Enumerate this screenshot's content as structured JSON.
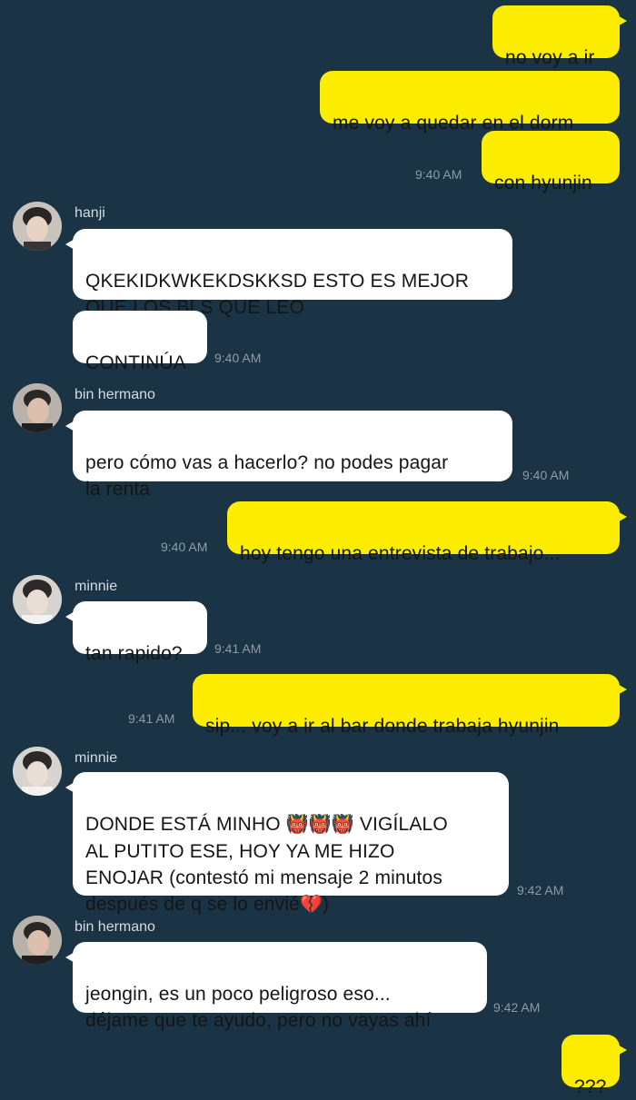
{
  "messages": {
    "m1": "no voy a ir",
    "m2": "me voy a quedar en el dorm",
    "m3": "con hyunjin",
    "t1": "9:40 AM",
    "n1": "hanji",
    "m4": "QKEKIDKWKEKDSKKSD ESTO ES MEJOR\nQUE LOS BLS QUE LEO",
    "m5": "CONTINÚA",
    "t2": "9:40 AM",
    "n2": "bin hermano",
    "m6": "pero cómo vas a hacerlo? no podes pagar\nla renta",
    "t3": "9:40 AM",
    "m7": "hoy tengo una entrevista de trabajo...",
    "t4": "9:40 AM",
    "n3": "minnie",
    "m8": "tan rapido?",
    "t5": "9:41 AM",
    "m9": "sip... voy a ir al bar donde trabaja hyunjin",
    "t6": "9:41 AM",
    "n4": "minnie",
    "m10_a": "DONDE ESTÁ MINHO ",
    "m10_e": "👹👹👹",
    "m10_b": " VIGÍLALO\nAL PUTITO ESE, HOY YA ME HIZO\nENOJAR (contestó mi mensaje 2 minutos\ndespués de q se lo envié",
    "m10_e2": "💔",
    "m10_c": ")",
    "t7": "9:42 AM",
    "n5": "bin hermano",
    "m11": "jeongin, es un poco peligroso eso...\ndéjame que te ayudo, pero no vayas ahí",
    "t8": "9:42 AM",
    "m12": "???"
  },
  "colors": {
    "background": "#1b3445",
    "outgoing": "#fcec00",
    "incoming": "#ffffff",
    "timestamp": "#8e9ba6"
  },
  "icons": {
    "avatar_hanji": "avatar",
    "avatar_bin": "avatar",
    "avatar_minnie": "avatar"
  }
}
